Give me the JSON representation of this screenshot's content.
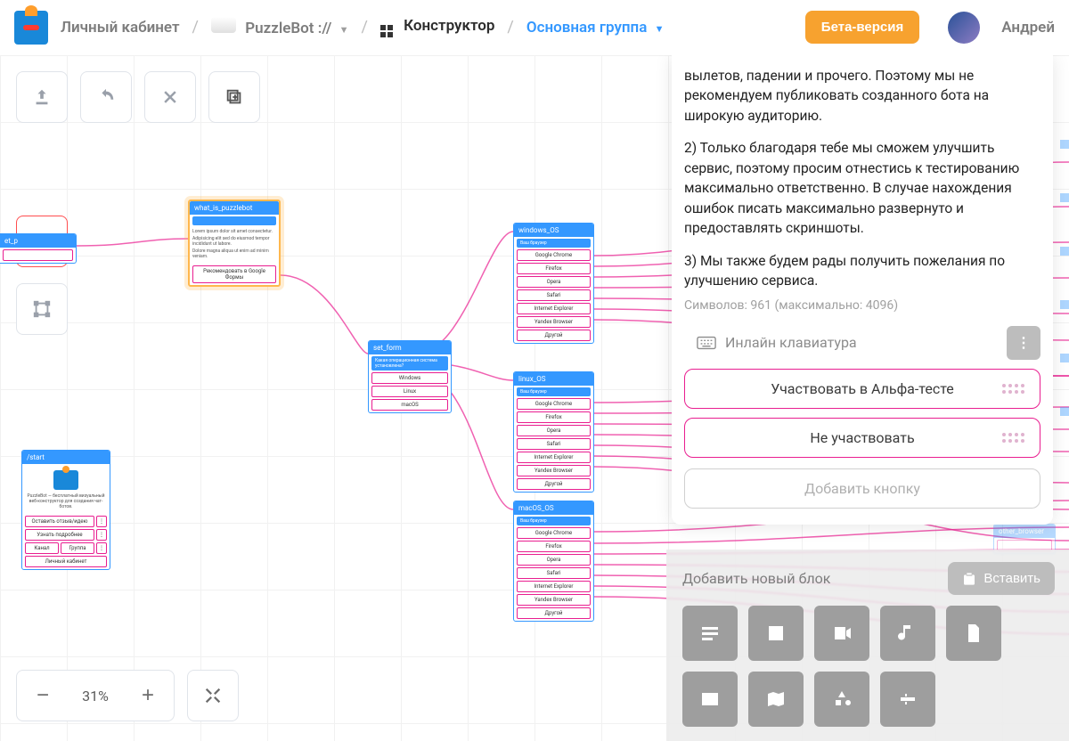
{
  "topbar": {
    "breadcrumb1": "Личный кабинет",
    "breadcrumb2": "PuzzleBot ://",
    "breadcrumb3": "Конструктор",
    "breadcrumb4": "Основная группа",
    "beta_label": "Бета-версия",
    "username": "Андрей"
  },
  "zoom": {
    "value": "31%"
  },
  "panel": {
    "para1_partial": "вылетов, падении и прочего. Поэтому мы не рекомендуем публиковать созданного бота на широкую аудиторию.",
    "para2": "2) Только благодаря тебе мы сможем улучшить сервис, поэтому просим отнестись к тестированию максимально ответственно. В случае нахождения ошибок писать максимально развернуто и предоставлять скриншоты.",
    "para3": "3) Мы также будем рады получить пожелания по улучшению сервиса.",
    "char_count": "Символов: 961 (максимально: 4096)",
    "keyboard_type": "Инлайн клавиатура",
    "btn1": "Участвовать в Альфа-тесте",
    "btn2": "Не участвовать",
    "add_button": "Добавить кнопку"
  },
  "palette": {
    "title": "Добавить новый блок",
    "paste": "Вставить",
    "items": [
      {
        "name": "text"
      },
      {
        "name": "image"
      },
      {
        "name": "video"
      },
      {
        "name": "audio"
      },
      {
        "name": "file"
      },
      {
        "name": "contact"
      },
      {
        "name": "location"
      },
      {
        "name": "shapes"
      },
      {
        "name": "form"
      }
    ]
  },
  "nodes": {
    "start": {
      "title": "/start",
      "desc": "PuzzleBot — бесплатный визуальный веб-конструктор для создания чат-ботов.",
      "buttons": [
        "Оставить отзыв/идею",
        "Узнать подробнее"
      ],
      "row": [
        "Канал",
        "Группа"
      ],
      "last": "Личный кабинет"
    },
    "what_is": {
      "title": "what_is_puzzlebot",
      "button": "Рекомендовать в Google Формы"
    },
    "set_form": {
      "title": "set_form",
      "sub": "Какая операционная система установлена?",
      "buttons": [
        "Windows",
        "Linux",
        "macOS"
      ]
    },
    "windows": {
      "title": "windows_OS",
      "sub": "Ваш браузер",
      "options": [
        "Google Chrome",
        "Firefox",
        "Opera",
        "Safari",
        "Internet Explorer",
        "Yandex Browser",
        "Другой"
      ]
    },
    "linux": {
      "title": "linux_OS",
      "sub": "Ваш браузер",
      "options": [
        "Google Chrome",
        "Firefox",
        "Opera",
        "Safari",
        "Internet Explorer",
        "Yandex Browser",
        "Другой"
      ]
    },
    "macos": {
      "title": "macOS_OS",
      "sub": "Ваш браузер",
      "options": [
        "Google Chrome",
        "Firefox",
        "Opera",
        "Safari",
        "Internet Explorer",
        "Yandex Browser",
        "Другой"
      ]
    },
    "cut": {
      "title": "et_p"
    }
  }
}
